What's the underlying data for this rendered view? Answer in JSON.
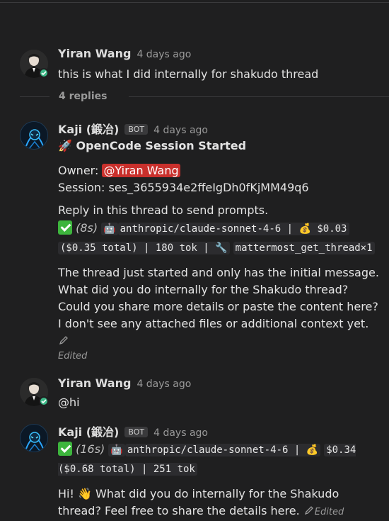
{
  "posts": [
    {
      "author": "Yiran Wang",
      "time": "4 days ago",
      "text": "this is what I did internally for shakudo thread"
    },
    {
      "author": "Kaji (鍛冶)",
      "badge": "BOT",
      "time": "4 days ago",
      "title": "OpenCode Session Started",
      "owner_label": "Owner:",
      "owner_mention": "@Yiran Wang",
      "session_label": "Session:",
      "session_id": "ses_3655934e2ffeIgDh0fKjMM49q6",
      "reply_hint": "Reply in this thread to send prompts.",
      "duration": "(8s)",
      "stats_line1": "anthropic/claude-sonnet-4-6 | 💰 $0.03",
      "stats_line2": "($0.35 total) | 180 tok | 🔧",
      "stats_line3": "mattermost_get_thread×1",
      "body": "The thread just started and only has the initial message. What did you do internally for the Shakudo thread? Could you share more details or paste the content here? I don't see any attached files or additional context yet.",
      "edited": "Edited"
    },
    {
      "author": "Yiran Wang",
      "time": "4 days ago",
      "text": "@hi"
    },
    {
      "author": "Kaji (鍛冶)",
      "badge": "BOT",
      "time": "4 days ago",
      "duration": "(16s)",
      "stats_line1": "anthropic/claude-sonnet-4-6 | 💰",
      "stats_line2": "$0.34 ($0.68 total) | 251 tok",
      "body_pre": "Hi! ",
      "body_post": " What did you do internally for the Shakudo thread? Feel free to share the details here.",
      "edited": "Edited"
    }
  ],
  "replies_label": "4 replies",
  "colors": {
    "background": "#1f1f20",
    "mention_bg": "#c9302c",
    "online": "#3db887",
    "check": "#3db53d"
  }
}
